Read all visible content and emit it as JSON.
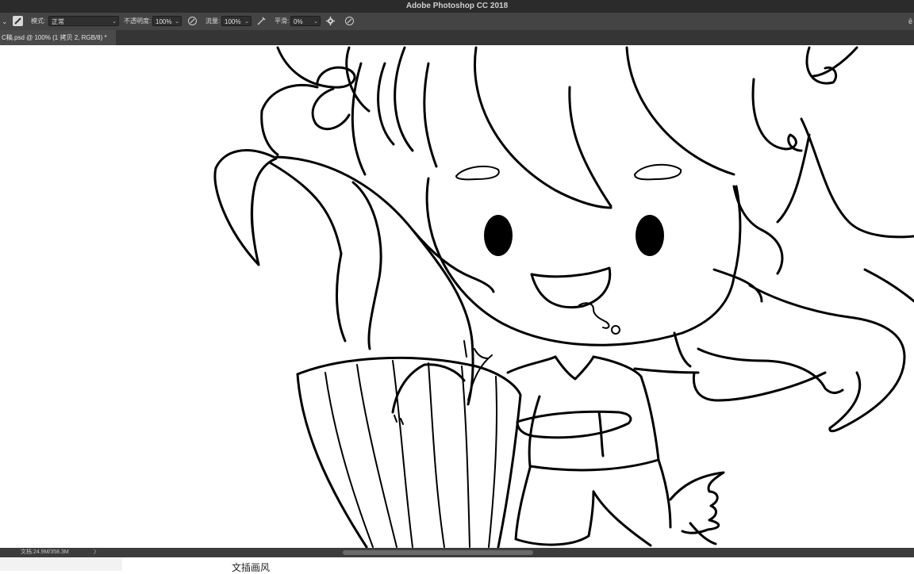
{
  "app": {
    "title": "Adobe Photoshop CC 2018"
  },
  "options_bar": {
    "mode_label": "模式:",
    "mode_value": "正常",
    "opacity_label": "不透明度:",
    "opacity_value": "100%",
    "flow_label": "流量:",
    "flow_value": "100%",
    "smoothing_label": "平滑:",
    "smoothing_value": "0%",
    "right_glyph": "ē"
  },
  "document": {
    "tab_title": "C稿.psd @ 100% (1 拷贝 2, RGB/8) *"
  },
  "status": {
    "doc_size": "文档:24.9M/358.3M",
    "arrow": "〉"
  },
  "bottom": {
    "text": "文插画风"
  },
  "colors": {
    "ui_dark": "#2b2b2b",
    "options_bg": "#444444",
    "canvas": "#ffffff",
    "ink": "#000000"
  }
}
